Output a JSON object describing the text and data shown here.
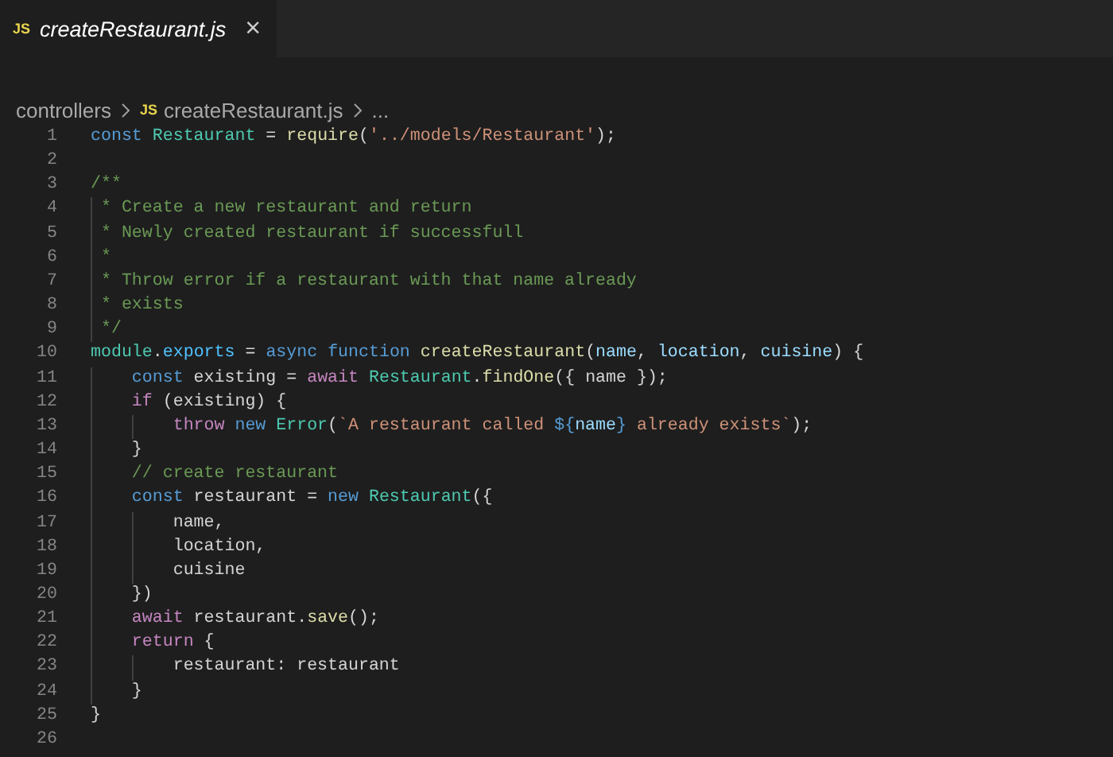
{
  "tabs": [
    {
      "icon_label": "JS",
      "title": "createRestaurant.js",
      "close": "×",
      "selected": true
    }
  ],
  "breadcrumb": [
    {
      "kind": "folder",
      "text": "controllers"
    },
    {
      "kind": "file",
      "icon_label": "JS",
      "text": "createRestaurant.js"
    },
    {
      "kind": "more",
      "text": "..."
    }
  ],
  "lines": [
    {
      "number": "1",
      "tokens": [
        {
          "kind": "keyword",
          "text": "const "
        },
        {
          "kind": "class",
          "text": "Restaurant"
        },
        {
          "kind": "plain",
          "text": " = "
        },
        {
          "kind": "function",
          "text": "require"
        },
        {
          "kind": "plain",
          "text": "("
        },
        {
          "kind": "string",
          "text": "'../models/Restaurant'"
        },
        {
          "kind": "plain",
          "text": ");"
        }
      ]
    },
    {
      "number": "2"
    },
    {
      "number": "3",
      "tokens": [
        {
          "kind": "comment",
          "text": "/**"
        }
      ]
    },
    {
      "number": "4",
      "tokens": [
        {
          "kind": "comment",
          "text": " * Create a new restaurant and return"
        }
      ]
    },
    {
      "number": "5",
      "tokens": [
        {
          "kind": "comment",
          "text": " * Newly created restaurant if successfull"
        }
      ]
    },
    {
      "number": "6",
      "tokens": [
        {
          "kind": "comment",
          "text": " *"
        }
      ]
    },
    {
      "number": "7",
      "tokens": [
        {
          "kind": "comment",
          "text": " * Throw error if a restaurant with that name already"
        }
      ]
    },
    {
      "number": "8",
      "tokens": [
        {
          "kind": "comment",
          "text": " * exists"
        }
      ]
    },
    {
      "number": "9",
      "tokens": [
        {
          "kind": "comment",
          "text": " */"
        }
      ]
    },
    {
      "number": "10",
      "tokens": [
        {
          "kind": "class",
          "text": "module"
        },
        {
          "kind": "plain",
          "text": "."
        },
        {
          "kind": "property",
          "text": "exports"
        },
        {
          "kind": "plain",
          "text": " = "
        },
        {
          "kind": "keyword",
          "text": "async function "
        },
        {
          "kind": "function",
          "text": "createRestaurant"
        },
        {
          "kind": "plain",
          "text": "("
        },
        {
          "kind": "variable",
          "text": "name"
        },
        {
          "kind": "plain",
          "text": ", "
        },
        {
          "kind": "variable",
          "text": "location"
        },
        {
          "kind": "plain",
          "text": ", "
        },
        {
          "kind": "variable",
          "text": "cuisine"
        },
        {
          "kind": "plain",
          "text": ") {"
        }
      ]
    },
    {
      "number": "11",
      "tokens": [
        {
          "kind": "keyword",
          "text": "    const"
        },
        {
          "kind": "plain",
          "text": " existing = "
        },
        {
          "kind": "control",
          "text": "await "
        },
        {
          "kind": "class",
          "text": "Restaurant"
        },
        {
          "kind": "plain",
          "text": "."
        },
        {
          "kind": "function",
          "text": "findOne"
        },
        {
          "kind": "plain",
          "text": "({ name });"
        }
      ]
    },
    {
      "number": "12",
      "tokens": [
        {
          "kind": "control",
          "text": "    if"
        },
        {
          "kind": "plain",
          "text": " (existing) {"
        }
      ]
    },
    {
      "number": "13",
      "tokens": [
        {
          "kind": "control",
          "text": "        throw "
        },
        {
          "kind": "keyword",
          "text": "new "
        },
        {
          "kind": "class",
          "text": "Error"
        },
        {
          "kind": "plain",
          "text": "("
        },
        {
          "kind": "string",
          "text": "`A restaurant called "
        },
        {
          "kind": "keyword",
          "text": "${"
        },
        {
          "kind": "variable",
          "text": "name"
        },
        {
          "kind": "keyword",
          "text": "}"
        },
        {
          "kind": "string",
          "text": " already exists`"
        },
        {
          "kind": "plain",
          "text": ");"
        }
      ]
    },
    {
      "number": "14",
      "tokens": [
        {
          "kind": "plain",
          "text": "    }"
        }
      ]
    },
    {
      "number": "15",
      "tokens": [
        {
          "kind": "comment",
          "text": "    // create restaurant"
        }
      ]
    },
    {
      "number": "16",
      "tokens": [
        {
          "kind": "keyword",
          "text": "    const"
        },
        {
          "kind": "plain",
          "text": " restaurant = "
        },
        {
          "kind": "keyword",
          "text": "new "
        },
        {
          "kind": "class",
          "text": "Restaurant"
        },
        {
          "kind": "plain",
          "text": "({"
        }
      ]
    },
    {
      "number": "17",
      "tokens": [
        {
          "kind": "plain",
          "text": "        name,"
        }
      ]
    },
    {
      "number": "18",
      "tokens": [
        {
          "kind": "plain",
          "text": "        location,"
        }
      ]
    },
    {
      "number": "19",
      "tokens": [
        {
          "kind": "plain",
          "text": "        cuisine"
        }
      ]
    },
    {
      "number": "20",
      "tokens": [
        {
          "kind": "plain",
          "text": "    })"
        }
      ]
    },
    {
      "number": "21",
      "tokens": [
        {
          "kind": "control",
          "text": "    await"
        },
        {
          "kind": "plain",
          "text": " restaurant."
        },
        {
          "kind": "function",
          "text": "save"
        },
        {
          "kind": "plain",
          "text": "();"
        }
      ]
    },
    {
      "number": "22",
      "tokens": [
        {
          "kind": "control",
          "text": "    return"
        },
        {
          "kind": "plain",
          "text": " {"
        }
      ]
    },
    {
      "number": "23",
      "tokens": [
        {
          "kind": "plain",
          "text": "        restaurant: restaurant"
        }
      ]
    },
    {
      "number": "24",
      "tokens": [
        {
          "kind": "plain",
          "text": "    }"
        }
      ]
    },
    {
      "number": "25",
      "tokens": [
        {
          "kind": "plain",
          "text": "}"
        }
      ]
    },
    {
      "number": "26"
    }
  ]
}
